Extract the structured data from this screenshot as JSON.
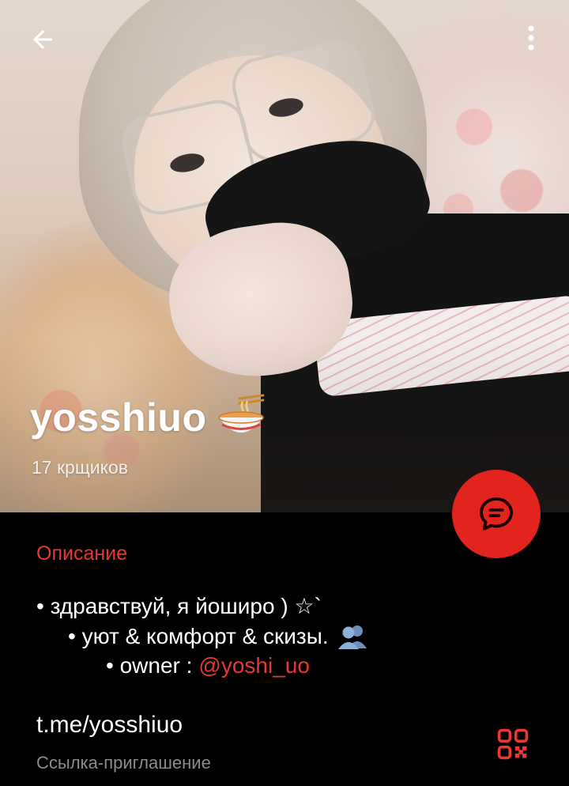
{
  "header": {
    "back_icon": "arrow-left-icon",
    "menu_icon": "more-vertical-icon"
  },
  "channel": {
    "name": "yosshiuo",
    "name_emoji": "noodle-bowl-icon",
    "subscribers": "17 крщиков"
  },
  "chat_button": {
    "icon": "chat-bubble-icon",
    "color": "#e3231d"
  },
  "description": {
    "title": "Описание",
    "line1": "• здравствуй, я йоширо ) ☆`",
    "line2": "• уют & комфорт & скизы.",
    "line2_icon": "people-icon",
    "line3_prefix": "• owner :",
    "line3_mention": "@yoshi_uo"
  },
  "link": {
    "value": "t.me/yosshiuo",
    "caption": "Ссылка-приглашение",
    "qr_icon": "qr-code-icon"
  },
  "colors": {
    "accent": "#e8382f",
    "background": "#000000",
    "secondary_text": "#8b8b8b"
  }
}
